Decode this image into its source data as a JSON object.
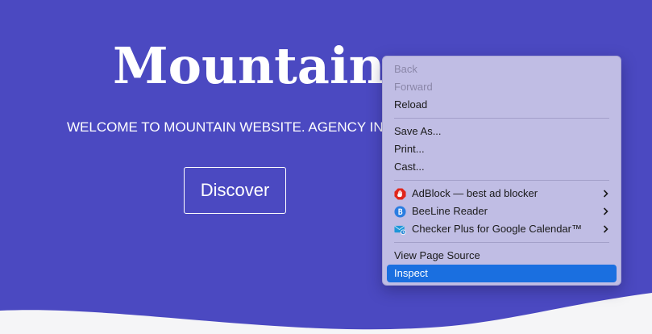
{
  "hero": {
    "title": "Mountain",
    "subtitle": "WELCOME TO MOUNTAIN WEBSITE. AGENCY IN BER",
    "cta_label": "Discover"
  },
  "colors": {
    "page_background": "#4b49c1",
    "menu_background": "#c0bde4",
    "menu_highlight": "#1a6fe0"
  },
  "context_menu": {
    "back": "Back",
    "forward": "Forward",
    "reload": "Reload",
    "save_as": "Save As...",
    "print": "Print...",
    "cast": "Cast...",
    "adblock": "AdBlock — best ad blocker",
    "beeline": "BeeLine Reader",
    "checker_plus": "Checker Plus for Google Calendar™",
    "view_source": "View Page Source",
    "inspect": "Inspect",
    "icons": {
      "adblock": "adblock-hand-icon",
      "beeline": "beeline-b-icon",
      "checker_plus": "calendar-envelope-icon",
      "submenu": "chevron-right-icon"
    }
  }
}
